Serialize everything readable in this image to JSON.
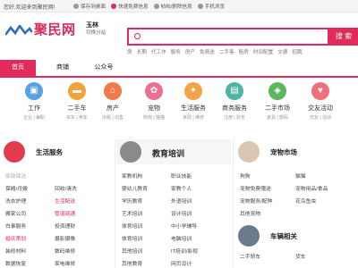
{
  "topbar": {
    "welcome": "您好,欢迎来到聚民网!",
    "links": [
      "保存到桌面",
      "快速免费信息",
      "帖帖/删除信息",
      "手机浏览"
    ]
  },
  "brand": {
    "name": "聚民网",
    "color": "#e22b5b"
  },
  "location": {
    "city": "玉林",
    "switch_label": "切换分站"
  },
  "search": {
    "placeholder": "",
    "button": "搜 索"
  },
  "hot_words": [
    "房",
    "长期",
    "代工作",
    "服务",
    "房产",
    "免费送",
    "二手客",
    "租房",
    "时间配置",
    "文德",
    "招聘"
  ],
  "nav": {
    "tabs": [
      "首页",
      "商铺",
      "公众号"
    ]
  },
  "categories": [
    {
      "name": "工作",
      "subs": "企业 | 兼职",
      "icon": "briefcase-icon",
      "color": "#58a1e6"
    },
    {
      "name": "二手车",
      "subs": "买车 | 卖车",
      "icon": "car-icon",
      "color": "#f0a33d"
    },
    {
      "name": "房产",
      "subs": "出租 | 出售",
      "icon": "house-icon",
      "color": "#f07a4a"
    },
    {
      "name": "宠物",
      "subs": "狗狗 | 猫猫",
      "icon": "paw-icon",
      "color": "#ec6f8e"
    },
    {
      "name": "生活服务",
      "subs": "家政 | 维修",
      "icon": "service-icon",
      "color": "#f2a447"
    },
    {
      "name": "商务服务",
      "subs": "注册 | 财务",
      "icon": "business-icon",
      "color": "#4fb4a1"
    },
    {
      "name": "二手市场",
      "subs": "家具 | 数码",
      "icon": "market-icon",
      "color": "#5bb75b"
    },
    {
      "name": "交友活动",
      "subs": "交友 | 活动",
      "icon": "heart-icon",
      "color": "#ef6f7a"
    }
  ],
  "panels": [
    {
      "title": "生活服务",
      "items": [
        "家政保洁",
        "",
        "保姆/月嫂",
        "回收/清洗",
        "洗衣护理",
        "生活配送",
        "搬家公司",
        "管道疏通",
        "白事服务",
        "投资理财",
        "婚庆策划",
        "摄影摄像",
        "装修材料",
        "数码维修",
        "数据恢复",
        "家电维修"
      ],
      "red": [
        5,
        7,
        10
      ],
      "icon_color": "#e23b4e"
    },
    {
      "title": "教育培训",
      "items": [
        "家教机构",
        "职业技能",
        "婴幼儿教育",
        "家教个人",
        "学历教育",
        "外语培训",
        "艺术培训",
        "设计培训",
        "体育培训",
        "中小学辅导",
        "体育培训",
        "电脑培训",
        "其他培训",
        "IT培训/影视",
        "其他教育",
        "网页设计"
      ],
      "red": [],
      "icon_color": "#8a8a8a"
    },
    {
      "title": "宠物市场",
      "items": [
        "狗狗",
        "猫猫",
        "宠物免费赠送",
        "宠物用品/食品",
        "宠物服务/配种",
        "花鸟鱼虫",
        "其他宠物",
        ""
      ],
      "red": [],
      "icon_color": "#d9c7b0"
    },
    {
      "title": "车辆相关",
      "items": [
        "二手轿车",
        "货车"
      ],
      "red": [],
      "icon_color": "#6b7a8c"
    }
  ]
}
